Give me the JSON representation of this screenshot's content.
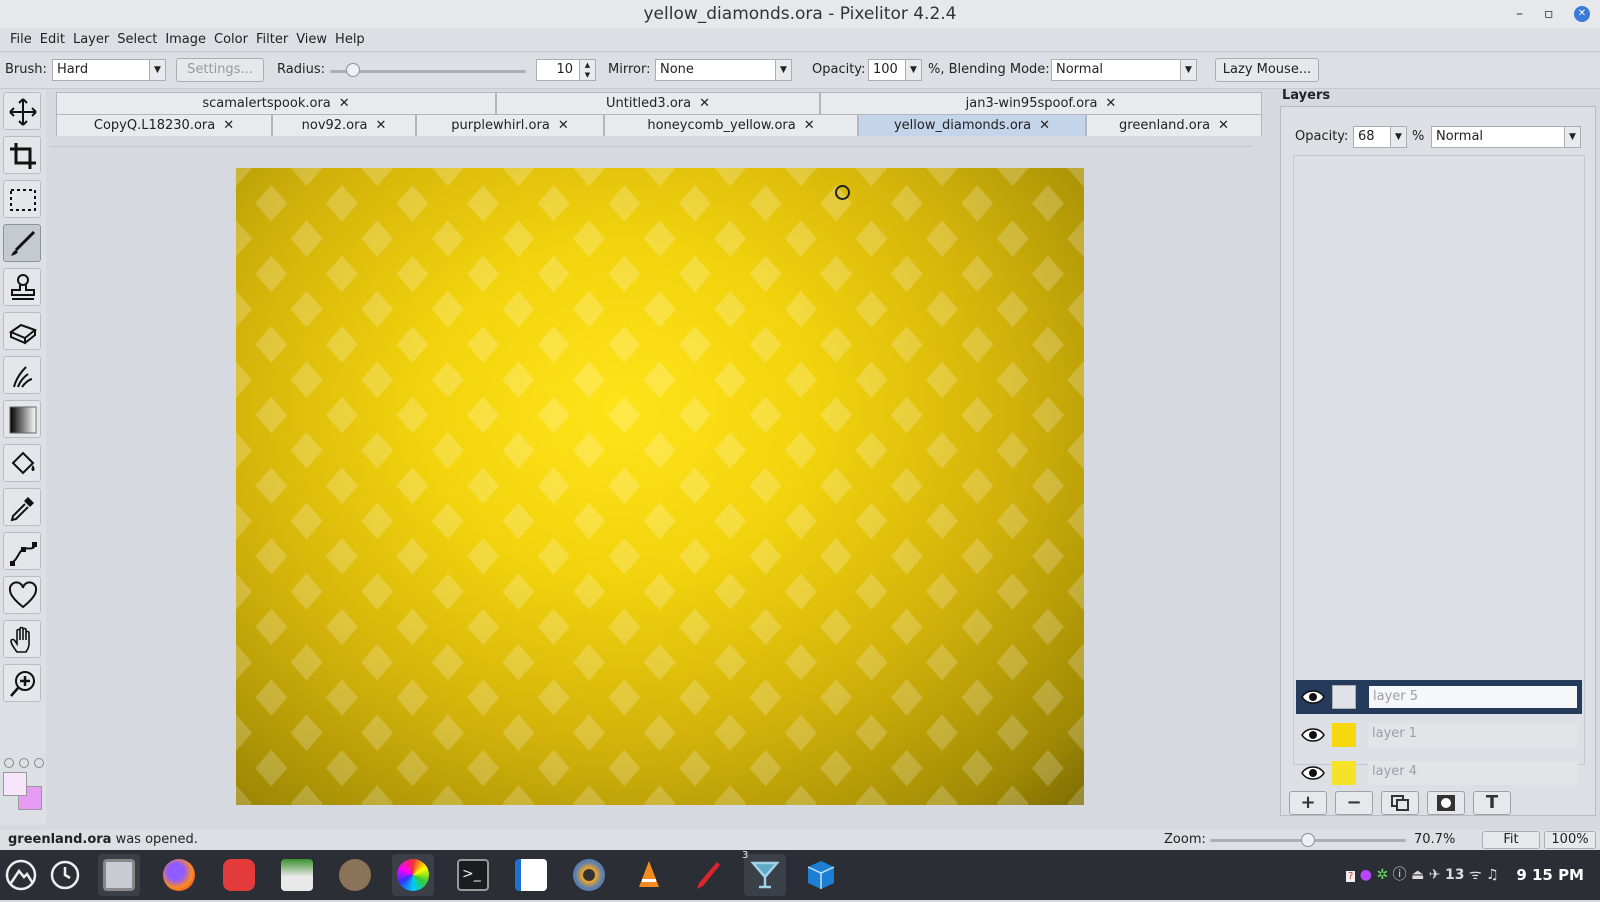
{
  "window": {
    "title": "yellow_diamonds.ora - Pixelitor 4.2.4",
    "minimize": "–",
    "maximize": "▫",
    "close": "✕"
  },
  "menu": [
    "File",
    "Edit",
    "Layer",
    "Select",
    "Image",
    "Color",
    "Filter",
    "View",
    "Help"
  ],
  "toolbar": {
    "brush_label": "Brush:",
    "brush_value": "Hard",
    "settings_label": "Settings...",
    "radius_label": "Radius:",
    "radius_value": "10",
    "mirror_label": "Mirror:",
    "mirror_value": "None",
    "opacity_label": "Opacity:",
    "opacity_value": "100",
    "blend_label": "%, Blending Mode:",
    "blend_value": "Normal",
    "lazy_mouse_label": "Lazy Mouse..."
  },
  "tools": [
    "move-icon",
    "crop-icon",
    "selection-icon",
    "brush-icon",
    "clone-stamp-icon",
    "eraser-icon",
    "smudge-icon",
    "gradient-icon",
    "paint-bucket-icon",
    "color-picker-icon",
    "pen-icon",
    "shapes-icon",
    "hand-icon",
    "zoom-icon"
  ],
  "colors": {
    "foreground": "#f7e6fb",
    "background": "#e59cf2"
  },
  "tabs_row1": [
    {
      "label": "scamalertspook.ora",
      "close": "✕"
    },
    {
      "label": "Untitled3.ora",
      "close": "✕"
    },
    {
      "label": "jan3-win95spoof.ora",
      "close": "✕"
    }
  ],
  "tabs_row2": [
    {
      "label": "CopyQ.L18230.ora",
      "close": "✕"
    },
    {
      "label": "nov92.ora",
      "close": "✕"
    },
    {
      "label": "purplewhirl.ora",
      "close": "✕"
    },
    {
      "label": "honeycomb_yellow.ora",
      "close": "✕"
    },
    {
      "label": "yellow_diamonds.ora",
      "close": "✕",
      "active": true
    },
    {
      "label": "greenland.ora",
      "close": "✕"
    }
  ],
  "layers_panel": {
    "title": "Layers",
    "opacity_label": "Opacity:",
    "opacity_value": "68",
    "percent": "%",
    "blend_value": "Normal",
    "layers": [
      {
        "name": "layer 5",
        "selected": true,
        "thumb_color": "#dfe3e8"
      },
      {
        "name": "layer 1",
        "selected": false,
        "thumb_color": "#f8d80c"
      },
      {
        "name": "layer 4",
        "selected": false,
        "thumb_color": "#f7e22a"
      }
    ],
    "buttons": [
      "add-layer-icon",
      "delete-layer-icon",
      "duplicate-layer-icon",
      "layer-mask-icon",
      "text-layer-icon"
    ]
  },
  "status": {
    "filename": "greenland.ora",
    "message": " was opened."
  },
  "zoom": {
    "label": "Zoom:",
    "value": "70.7%",
    "level": 0.5,
    "fit_label": "Fit",
    "hundred_label": "100%"
  },
  "taskbar": {
    "apps": [
      "system-icon",
      "clock-app-icon",
      "file-manager-icon",
      "firefox-icon",
      "discord-icon",
      "mail-icon",
      "gimp-icon",
      "color-app-icon",
      "terminal-icon",
      "writer-icon",
      "camera-icon",
      "vlc-icon",
      "pen-app-icon",
      "cocktail-app-icon",
      "virtualbox-icon"
    ],
    "badge": "3",
    "tray_count": "13",
    "clock": "9 15 PM"
  }
}
